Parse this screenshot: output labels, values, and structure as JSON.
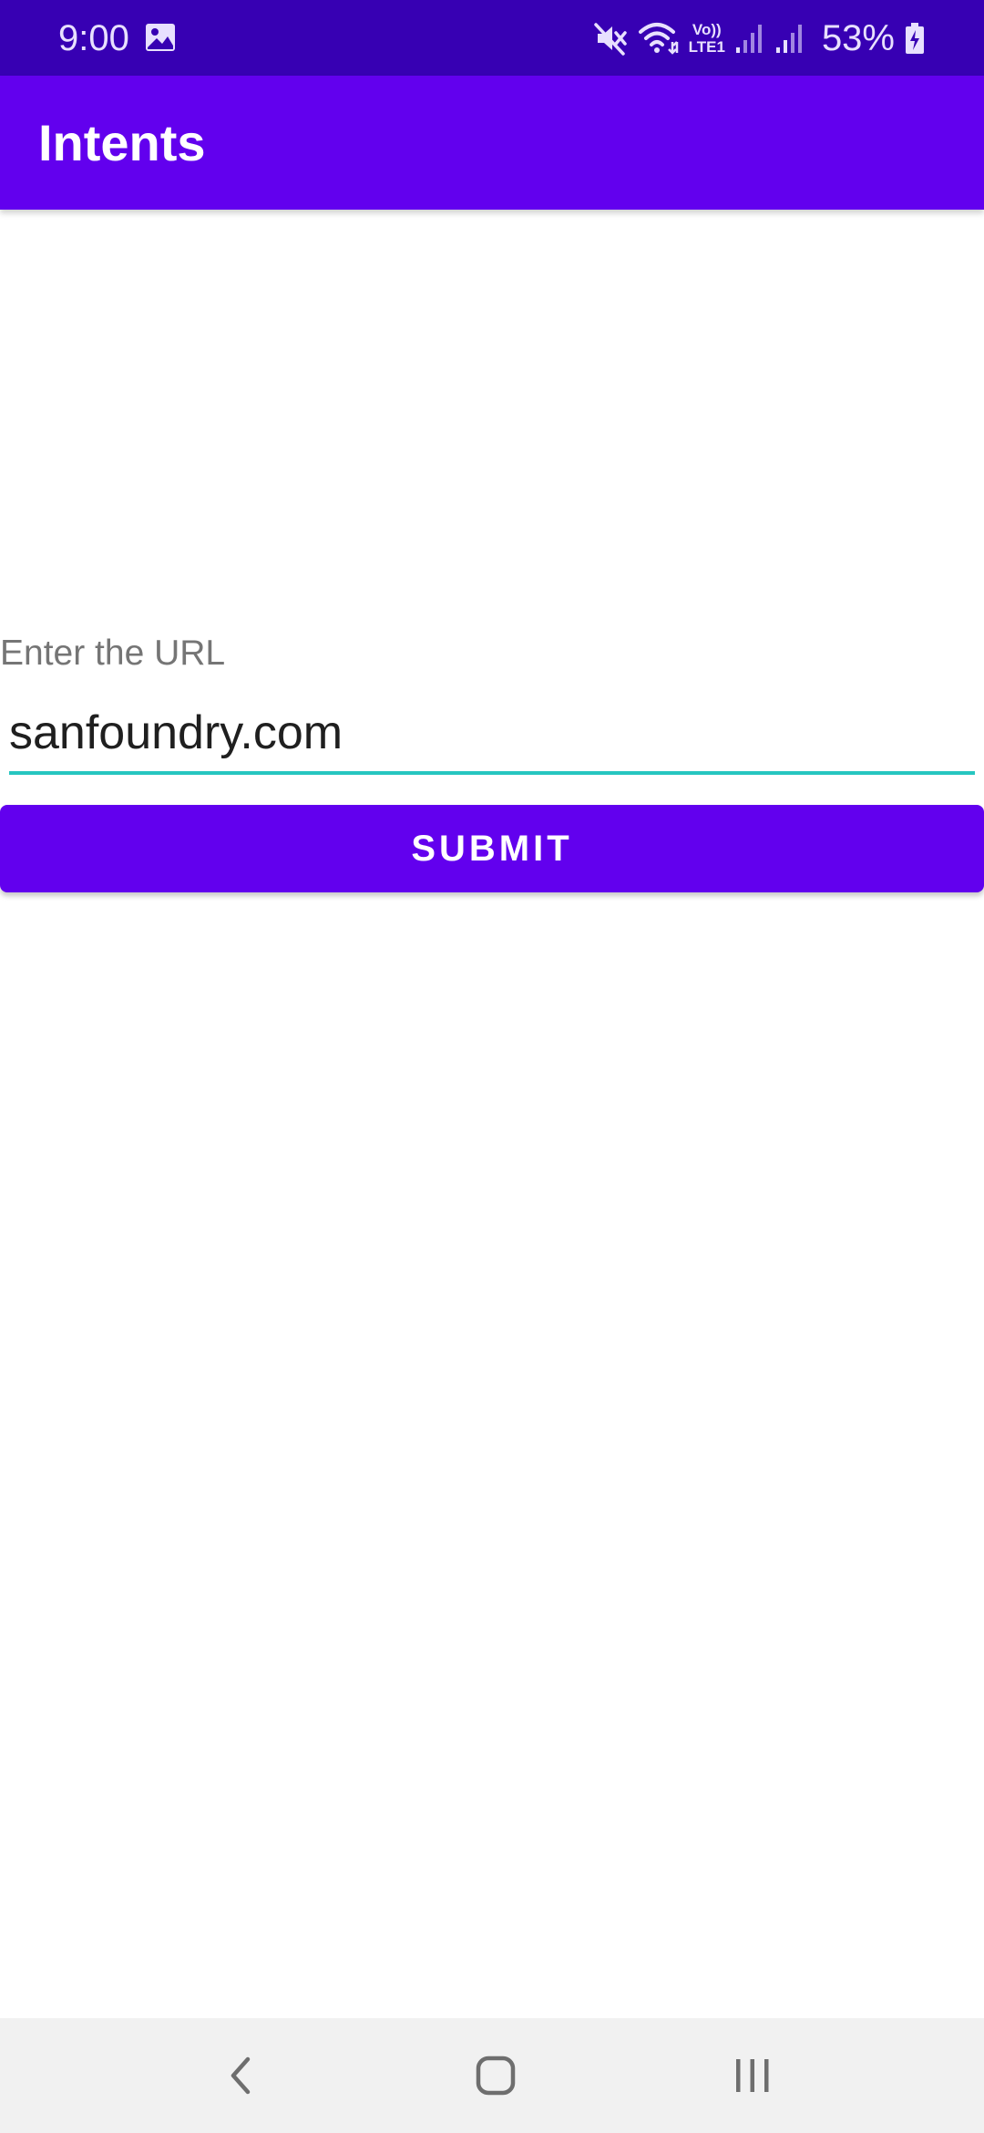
{
  "status_bar": {
    "time": "9:00",
    "battery_percent": "53%",
    "icons": [
      "gallery-icon",
      "mute-icon",
      "wifi-icon",
      "volte-icon",
      "signal-icon",
      "signal-icon",
      "battery-charging-icon"
    ],
    "volte_top": "Vo))",
    "volte_bottom": "LTE1",
    "background": "#3700b3"
  },
  "app_bar": {
    "title": "Intents",
    "color": "#6200ee"
  },
  "form": {
    "url_label": "Enter the URL",
    "url_value": "sanfoundry.com",
    "underline_color": "#26c6c0",
    "submit_label": "SUBMIT",
    "button_color": "#6200ee"
  },
  "nav_bar": {
    "icons": [
      "back-icon",
      "home-icon",
      "recent-apps-icon"
    ]
  }
}
